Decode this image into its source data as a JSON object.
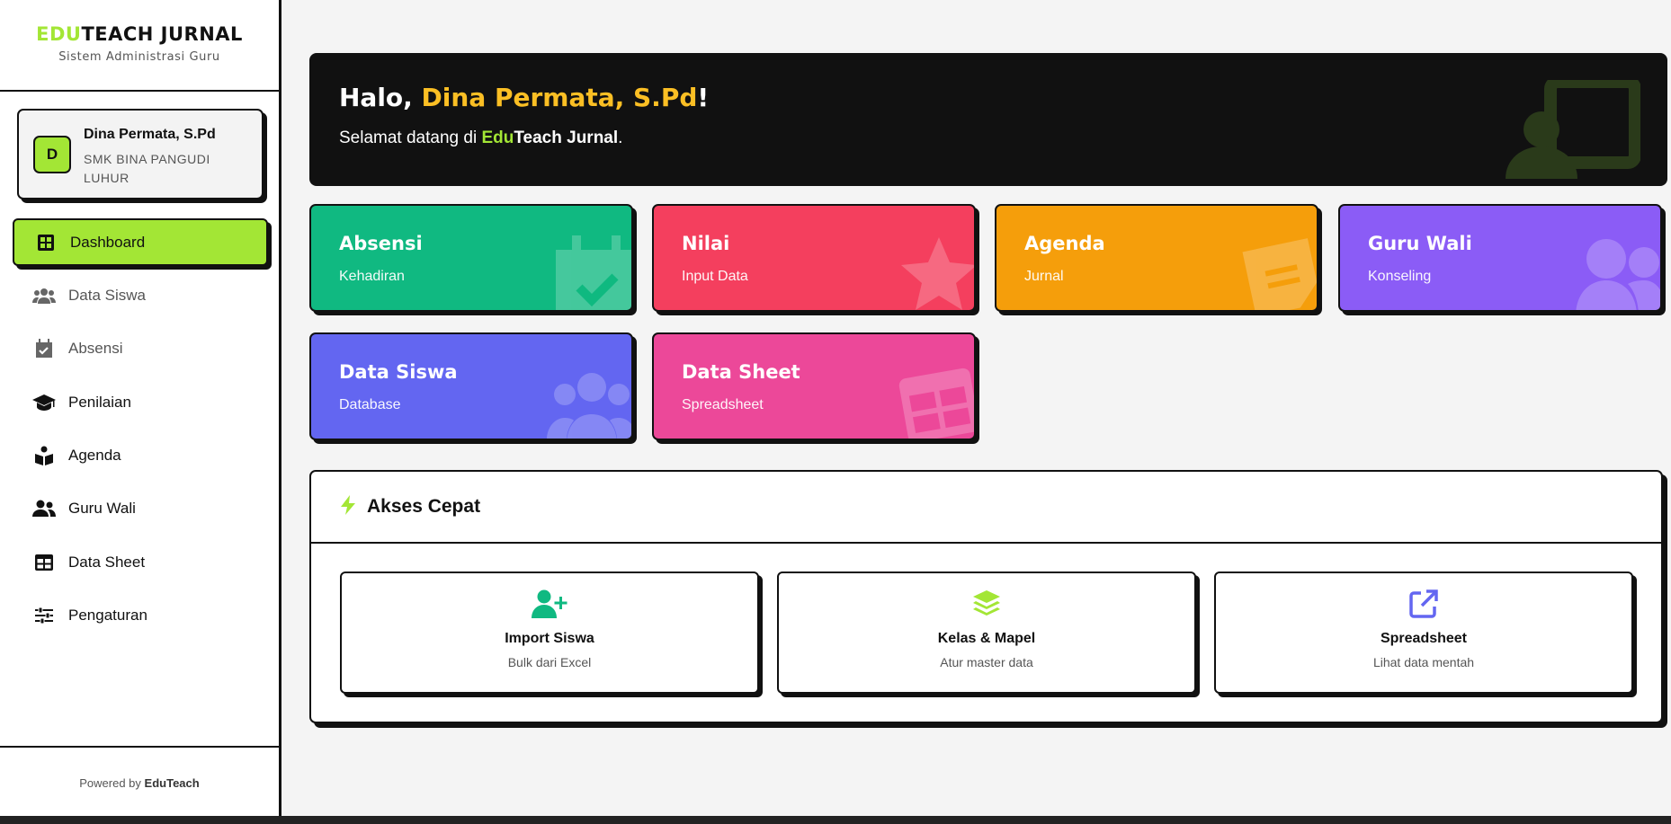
{
  "sidebar": {
    "brand_accent": "EDU",
    "brand_rest": "TEACH JURNAL",
    "brand_subtitle": "Sistem Administrasi Guru",
    "profile": {
      "initial": "D",
      "name": "Dina Permata, S.Pd",
      "school": "SMK BINA PANGUDI LUHUR"
    },
    "items": [
      {
        "label": "Dashboard",
        "icon": "grid-icon",
        "active": true
      },
      {
        "label": "Data Siswa",
        "icon": "users-icon",
        "muted": true
      },
      {
        "label": "Absensi",
        "icon": "calendar-check-icon",
        "muted": true
      },
      {
        "label": "Penilaian",
        "icon": "graduation-cap-icon"
      },
      {
        "label": "Agenda",
        "icon": "book-reader-icon"
      },
      {
        "label": "Guru Wali",
        "icon": "user-group-icon"
      },
      {
        "label": "Data Sheet",
        "icon": "table-icon"
      },
      {
        "label": "Pengaturan",
        "icon": "sliders-icon"
      }
    ],
    "footer_prefix": "Powered by",
    "footer_brand": "EduTeach"
  },
  "banner": {
    "greeting_prefix": "Halo, ",
    "greeting_name": "Dina Permata, S.Pd",
    "greeting_suffix": "!",
    "welcome_prefix": "Selamat datang di ",
    "welcome_edu": "Edu",
    "welcome_teach": "Teach Jurnal",
    "welcome_suffix": "."
  },
  "cards": [
    {
      "title": "Absensi",
      "subtitle": "Kehadiran",
      "color": "#10b981",
      "icon": "calendar-check-icon"
    },
    {
      "title": "Nilai",
      "subtitle": "Input Data",
      "color": "#f43f5e",
      "icon": "star-icon"
    },
    {
      "title": "Agenda",
      "subtitle": "Jurnal",
      "color": "#f59e0b",
      "icon": "note-icon"
    },
    {
      "title": "Guru Wali",
      "subtitle": "Konseling",
      "color": "#8b5cf6",
      "icon": "user-group-icon"
    },
    {
      "title": "Data Siswa",
      "subtitle": "Database",
      "color": "#6366f1",
      "icon": "users-icon"
    },
    {
      "title": "Data Sheet",
      "subtitle": "Spreadsheet",
      "color": "#ec4899",
      "icon": "table-icon"
    }
  ],
  "quick": {
    "title": "Akses Cepat",
    "items": [
      {
        "title": "Import Siswa",
        "subtitle": "Bulk dari Excel",
        "icon": "user-plus-icon",
        "color": "#10b981"
      },
      {
        "title": "Kelas & Mapel",
        "subtitle": "Atur master data",
        "icon": "layers-icon",
        "color": "#a3e635"
      },
      {
        "title": "Spreadsheet",
        "subtitle": "Lihat data mentah",
        "icon": "external-link-icon",
        "color": "#6366f1"
      }
    ]
  },
  "colors": {
    "accent": "#a3e635",
    "highlight": "#fbbf24",
    "dark": "#111111"
  }
}
